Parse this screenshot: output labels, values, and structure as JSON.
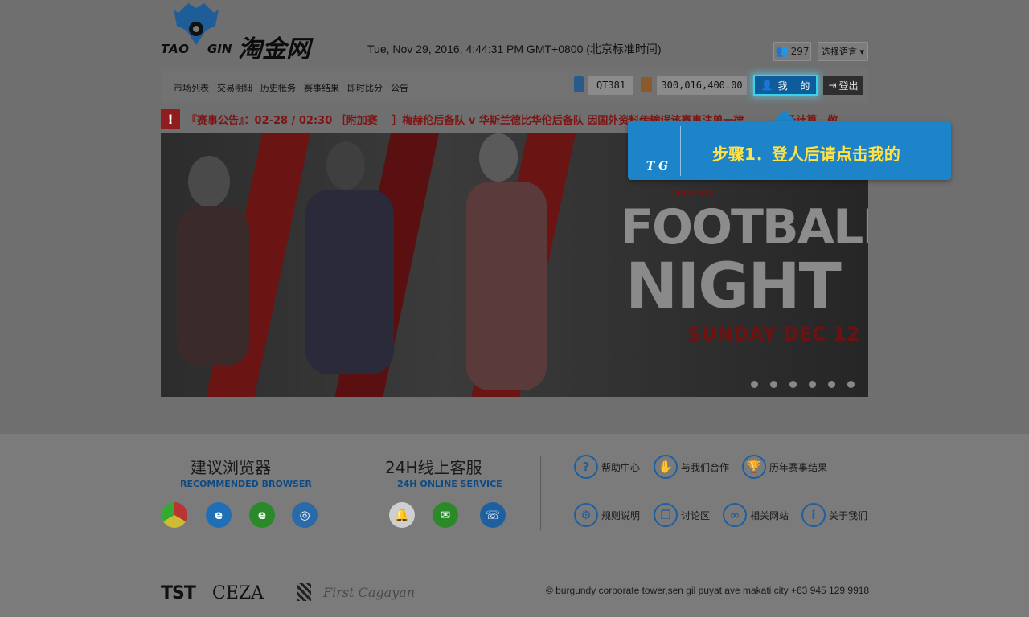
{
  "header": {
    "logo_en_left": "TAO",
    "logo_en_right": "GIN",
    "logo_cn": "淘金网",
    "datetime": "Tue, Nov 29, 2016, 4:44:31 PM GMT+0800 (北京标准时间)",
    "online_count": "297",
    "language_select": "选择语言 ▾"
  },
  "nav": {
    "links": [
      "市场列表",
      "交易明細",
      "历史帐务",
      "赛事结果",
      "即时比分",
      "公告"
    ],
    "account_id": "QT381",
    "balance": "300,016,400.00",
    "me_label": "我　 的",
    "logout_label": "登出"
  },
  "notice": {
    "icon": "!",
    "text": "『赛事公告』：02-28 / 02:30 ［附加赛　 ］梅赫伦后备队 v 华斯兰德比华伦后备队 因国外资料传输误该赛事注单一律　　　　予计算，敬"
  },
  "banner": {
    "small_line": "PRESENTS",
    "headline1": "FOOTBALL",
    "headline2": "NIGHT",
    "date_line": "SUNDAY DEC 12",
    "dots": 6
  },
  "tooltip": {
    "logo": "T G",
    "text": "步骤1．登人后请点击我的"
  },
  "footer": {
    "browser_title": "建议浏览器",
    "browser_sub": "RECOMMENDED BROWSER",
    "service_title": "24H线上客服",
    "service_sub": "24H ONLINE SERVICE",
    "links": [
      "帮助中心",
      "与我们合作",
      "历年赛事结果",
      "规则说明",
      "讨论区",
      "相关网站",
      "关于我们"
    ],
    "partners": [
      "TST",
      "CEZA",
      "First Cagayan"
    ],
    "address": "© burgundy corporate tower,sen gil puyat ave makati city +63 945 129 9918"
  },
  "colors": {
    "accent": "#1e84c9",
    "highlight": "#35d3ef",
    "notice_red": "#7d1414",
    "tip_text": "#ffe24a"
  }
}
